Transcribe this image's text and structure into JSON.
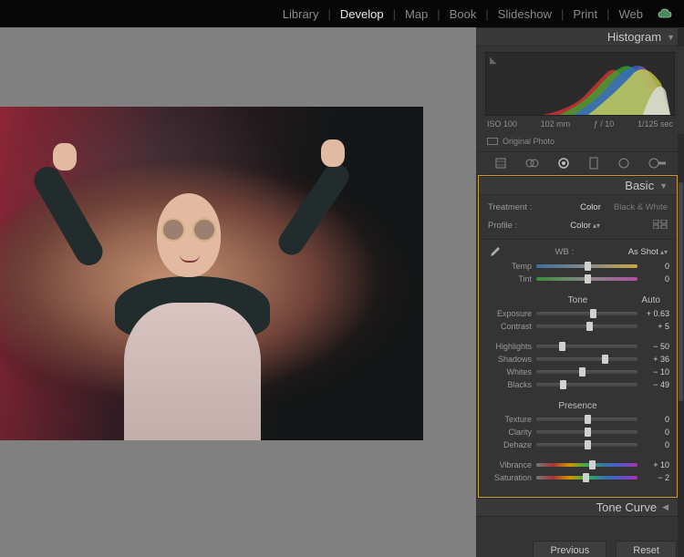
{
  "nav": {
    "modules": [
      "Library",
      "Develop",
      "Map",
      "Book",
      "Slideshow",
      "Print",
      "Web"
    ],
    "active": "Develop"
  },
  "histogram": {
    "title": "Histogram",
    "iso": "ISO 100",
    "focal": "102 mm",
    "aperture": "ƒ / 10",
    "shutter": "1/125 sec",
    "original": "Original Photo"
  },
  "basic": {
    "title": "Basic",
    "treatment_label": "Treatment :",
    "treatment_color": "Color",
    "treatment_bw": "Black & White",
    "profile_label": "Profile :",
    "profile_value": "Color",
    "wb_label": "WB :",
    "wb_value": "As Shot",
    "temp_label": "Temp",
    "temp_value": "0",
    "tint_label": "Tint",
    "tint_value": "0",
    "tone_label": "Tone",
    "auto_label": "Auto",
    "exposure_label": "Exposure",
    "exposure_value": "+ 0.63",
    "contrast_label": "Contrast",
    "contrast_value": "+ 5",
    "highlights_label": "Highlights",
    "highlights_value": "− 50",
    "shadows_label": "Shadows",
    "shadows_value": "+ 36",
    "whites_label": "Whites",
    "whites_value": "− 10",
    "blacks_label": "Blacks",
    "blacks_value": "− 49",
    "presence_label": "Presence",
    "texture_label": "Texture",
    "texture_value": "0",
    "clarity_label": "Clarity",
    "clarity_value": "0",
    "dehaze_label": "Dehaze",
    "dehaze_value": "0",
    "vibrance_label": "Vibrance",
    "vibrance_value": "+ 10",
    "saturation_label": "Saturation",
    "saturation_value": "− 2"
  },
  "tone_curve": {
    "title": "Tone Curve"
  },
  "buttons": {
    "previous": "Previous",
    "reset": "Reset"
  },
  "slider_positions": {
    "temp": 50,
    "tint": 50,
    "exposure": 56,
    "contrast": 52,
    "highlights": 25,
    "shadows": 68,
    "whites": 45,
    "blacks": 26,
    "texture": 50,
    "clarity": 50,
    "dehaze": 50,
    "vibrance": 55,
    "saturation": 49
  }
}
